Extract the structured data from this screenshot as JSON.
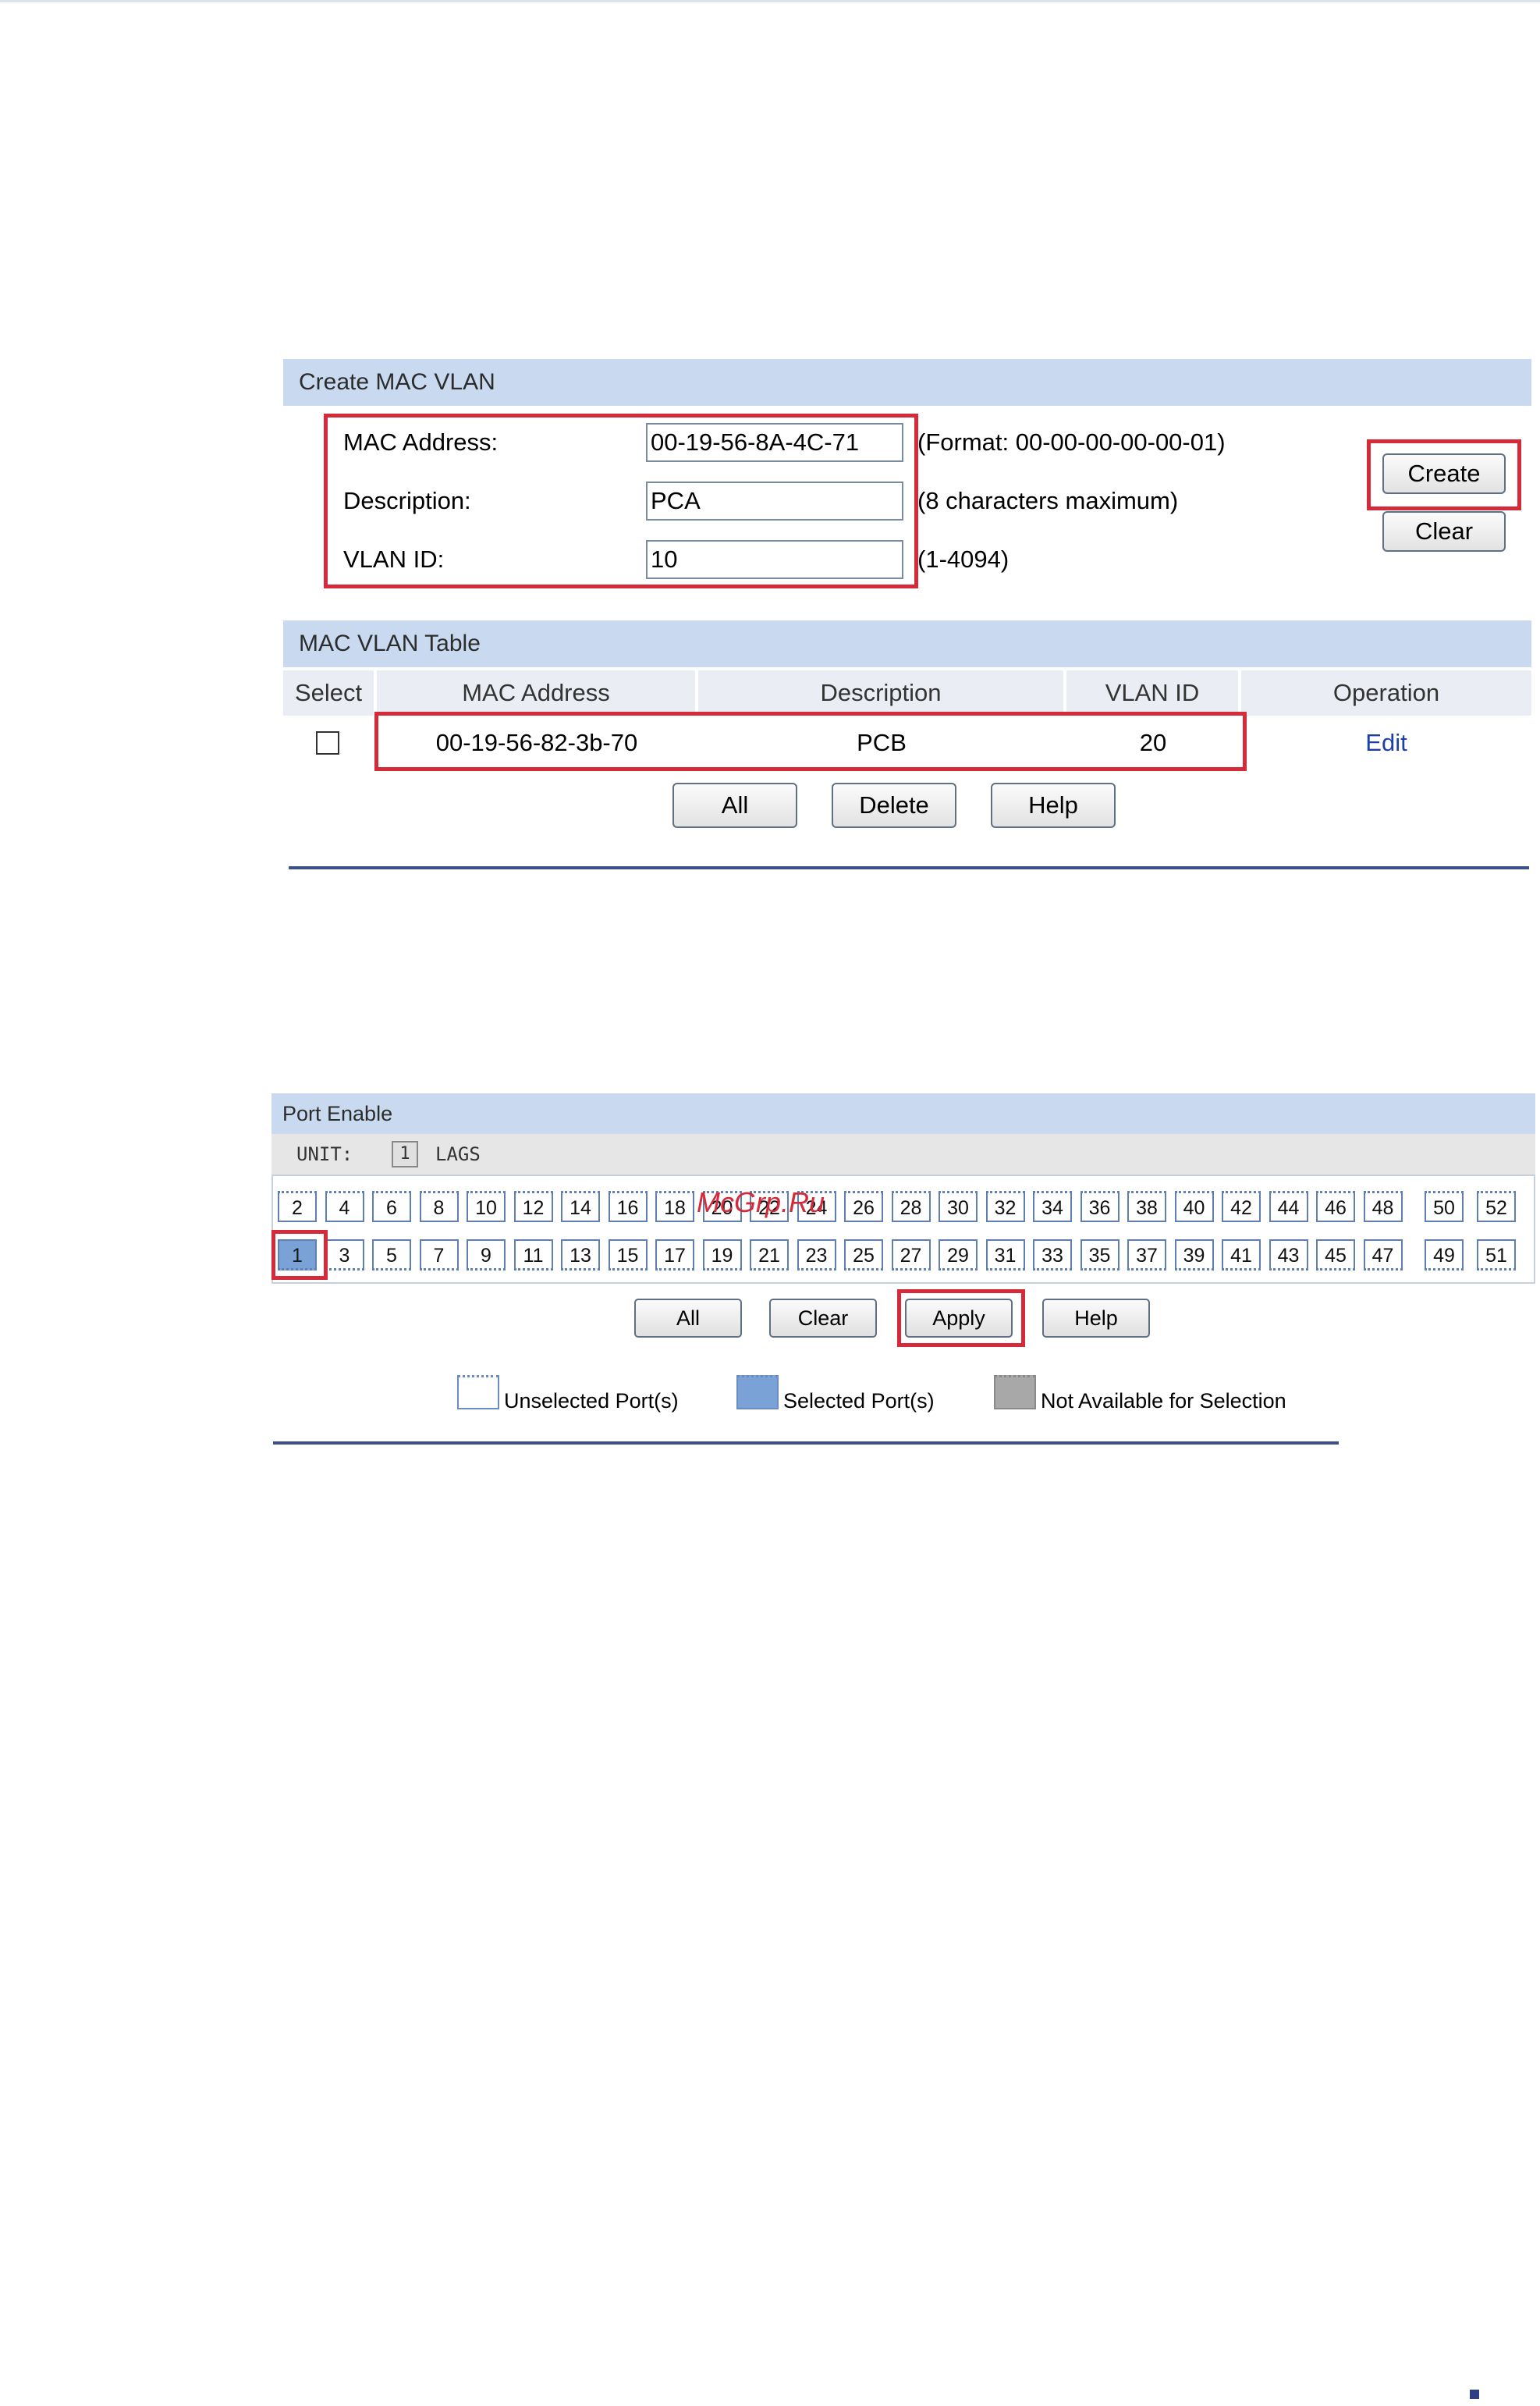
{
  "create_mac_vlan": {
    "title": "Create MAC VLAN",
    "mac_label": "MAC Address:",
    "mac_value": "00-19-56-8A-4C-71",
    "mac_hint": "(Format: 00-00-00-00-00-01)",
    "desc_label": "Description:",
    "desc_value": "PCA",
    "desc_hint": "(8 characters maximum)",
    "vlan_label": "VLAN ID:",
    "vlan_value": "10",
    "vlan_hint": "(1-4094)",
    "create_label": "Create",
    "clear_label": "Clear"
  },
  "mac_vlan_table": {
    "title": "MAC VLAN Table",
    "headers": [
      "Select",
      "MAC Address",
      "Description",
      "VLAN ID",
      "Operation"
    ],
    "rows": [
      {
        "mac": "00-19-56-82-3b-70",
        "description": "PCB",
        "vlan_id": "20",
        "operation": "Edit"
      }
    ],
    "all_label": "All",
    "delete_label": "Delete",
    "help_label": "Help"
  },
  "port_enable": {
    "title": "Port Enable",
    "unit_label": "UNIT:",
    "unit_value": "1",
    "lags_label": "LAGS",
    "top_ports": [
      "2",
      "4",
      "6",
      "8",
      "10",
      "12",
      "14",
      "16",
      "18",
      "20",
      "22",
      "24",
      "26",
      "28",
      "30",
      "32",
      "34",
      "36",
      "38",
      "40",
      "42",
      "44",
      "46",
      "48",
      "50",
      "52"
    ],
    "bottom_ports": [
      "1",
      "3",
      "5",
      "7",
      "9",
      "11",
      "13",
      "15",
      "17",
      "19",
      "21",
      "23",
      "25",
      "27",
      "29",
      "31",
      "33",
      "35",
      "37",
      "39",
      "41",
      "43",
      "45",
      "47",
      "49",
      "51"
    ],
    "selected_ports": [
      "1"
    ],
    "all_label": "All",
    "clear_label": "Clear",
    "apply_label": "Apply",
    "help_label": "Help",
    "legend": {
      "unselected": "Unselected Port(s)",
      "selected": "Selected Port(s)",
      "not_available": "Not Available for Selection"
    },
    "watermark": "McGrp.Ru"
  },
  "colors": {
    "section_bar": "#c9daf0",
    "highlight_red": "#d42a3a",
    "divider_blue": "#3c4f86",
    "selected_port": "#7aa2d6",
    "unavailable_port": "#a8a8a8"
  }
}
